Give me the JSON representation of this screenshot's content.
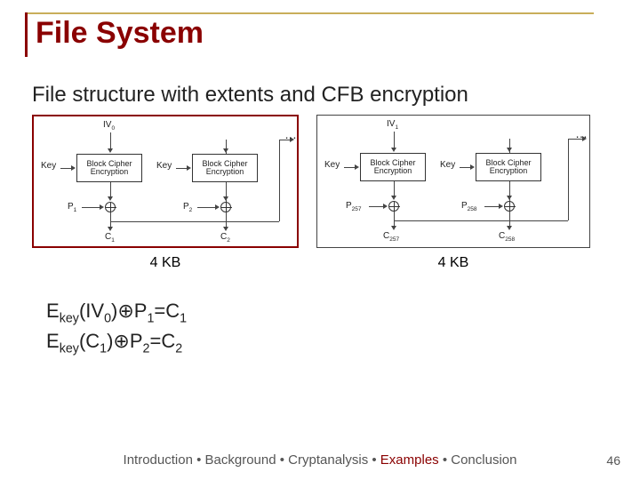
{
  "title": "File System",
  "subtitle": "File structure with extents and CFB encryption",
  "labels": {
    "key": "Key",
    "block": "Block Cipher Encryption",
    "dots": "…"
  },
  "diag1": {
    "iv": "IV",
    "iv_sub": "0",
    "p1": "P",
    "p1_sub": "1",
    "p2": "P",
    "p2_sub": "2",
    "c1": "C",
    "c1_sub": "1",
    "c2": "C",
    "c2_sub": "2"
  },
  "diag2": {
    "iv": "IV",
    "iv_sub": "1",
    "p1": "P",
    "p1_sub": "257",
    "p2": "P",
    "p2_sub": "258",
    "c1": "C",
    "c1_sub": "257",
    "c2": "C",
    "c2_sub": "258"
  },
  "size": "4 KB",
  "eq1": {
    "pre": "E",
    "sub1": "key",
    "mid1": "(IV",
    "sub2": "0",
    "mid2": ")⊕P",
    "sub3": "1",
    "mid3": "=C",
    "sub4": "1"
  },
  "eq2": {
    "pre": "E",
    "sub1": "key",
    "mid1": "(C",
    "sub2": "1",
    "mid2": ")⊕P",
    "sub3": "2",
    "mid3": "=C",
    "sub4": "2"
  },
  "footer": {
    "a": "Introduction",
    "b": "Background",
    "c": "Cryptanalysis",
    "d": "Examples",
    "e": "Conclusion",
    "sep": " • "
  },
  "page": "46"
}
